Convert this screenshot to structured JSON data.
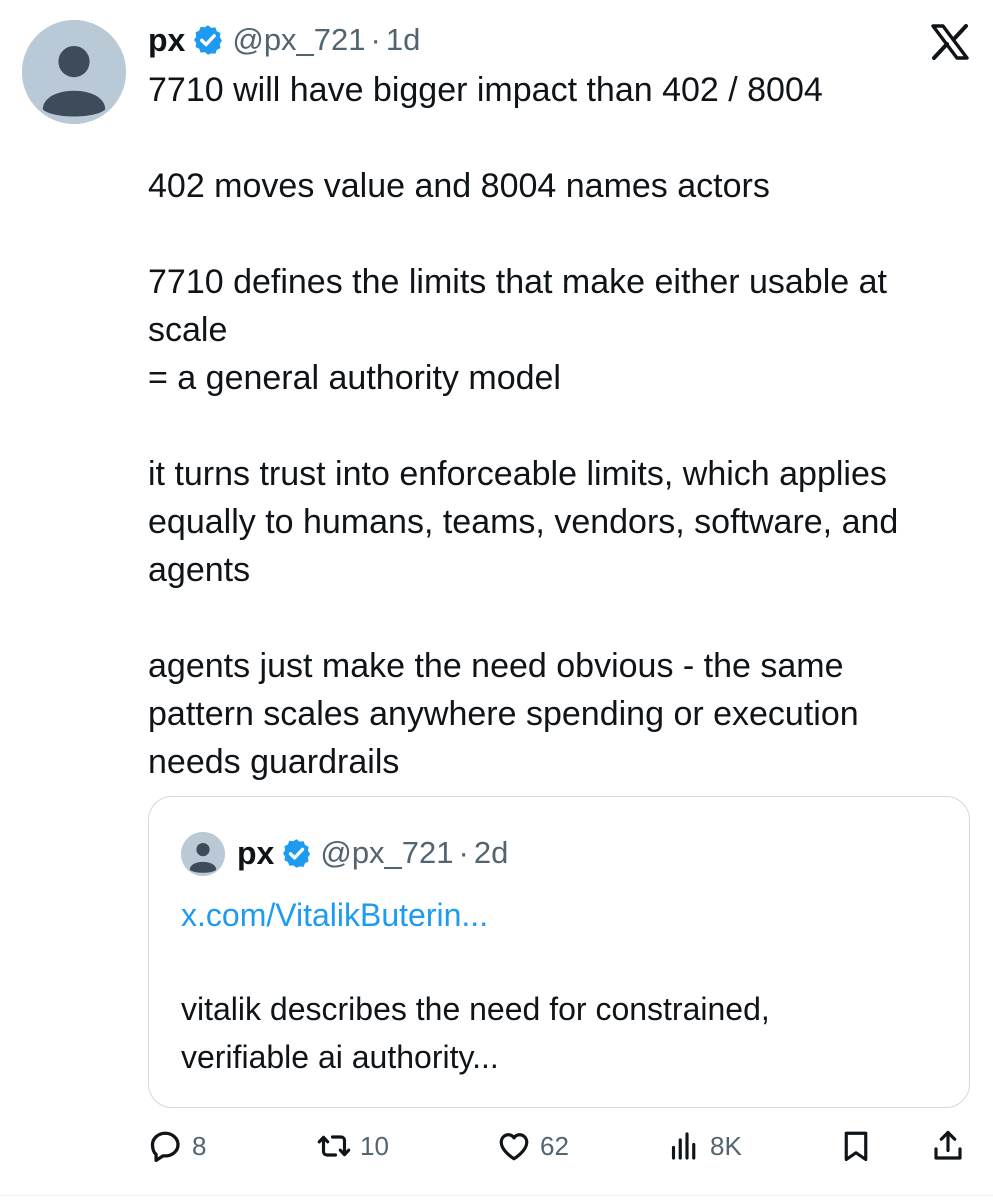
{
  "post": {
    "author": {
      "name": "px",
      "handle": "@px_721",
      "separator": "·",
      "time": "1d"
    },
    "lines": [
      "7710 will have bigger impact than 402 / 8004",
      "",
      "402 moves value and 8004 names actors",
      "",
      "7710 defines the limits that make either usable at",
      "scale",
      "= a general authority model",
      "",
      "it turns trust into enforceable limits, which applies",
      "equally to humans, teams, vendors, software, and",
      "agents",
      "",
      "agents just make the need obvious - the same",
      "pattern scales anywhere spending or execution",
      "needs guardrails"
    ]
  },
  "quoted": {
    "author": {
      "name": "px",
      "handle": "@px_721",
      "separator": "·",
      "time": "2d"
    },
    "link": "x.com/VitalikButerin...",
    "lines": [
      "vitalik describes the need for constrained,",
      "verifiable ai authority..."
    ]
  },
  "actions": {
    "replies": "8",
    "reposts": "10",
    "likes": "62",
    "views": "8K"
  },
  "icons": {
    "verified": "verified-badge-icon",
    "brand": "x-logo-icon",
    "reply": "reply-icon",
    "repost": "repost-icon",
    "like": "like-icon",
    "views": "views-icon",
    "bookmark": "bookmark-icon",
    "share": "share-icon"
  },
  "colors": {
    "accent": "#1d9bf0",
    "text": "#0f1419",
    "secondary": "#536471",
    "border": "#cfd9de",
    "avatar_bg": "#b9cad6",
    "avatar_fg": "#3d4b5a"
  }
}
